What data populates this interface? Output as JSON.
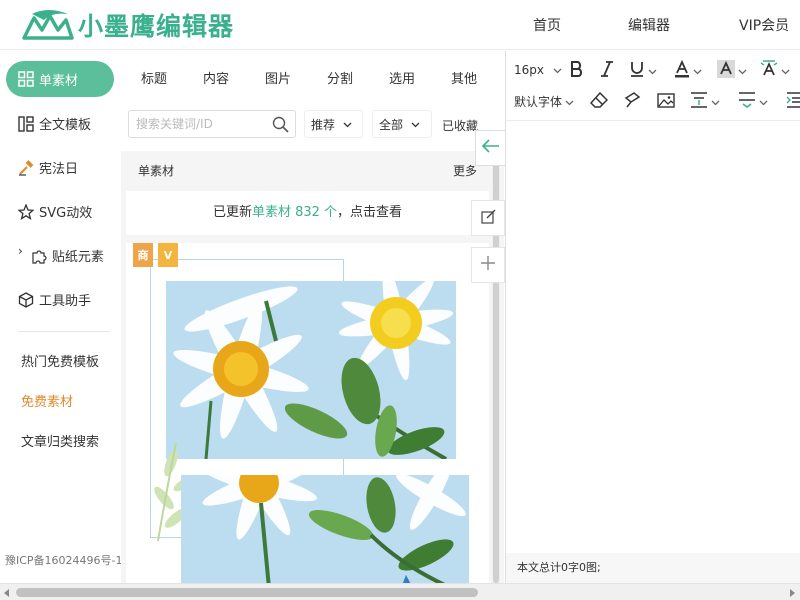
{
  "app": {
    "logo_text": "小墨鹰编辑器",
    "brand_color": "#3bb08d",
    "nav": [
      "首页",
      "编辑器",
      "VIP会员"
    ]
  },
  "sidebar": {
    "active": {
      "label": "单素材",
      "icon": "grid-icon"
    },
    "items": [
      {
        "label": "全文模板",
        "icon": "template-icon"
      },
      {
        "label": "宪法日",
        "icon": "hammer-icon"
      },
      {
        "label": "SVG动效",
        "icon": "star-icon"
      },
      {
        "label": "贴纸元素",
        "icon": "puzzle-icon"
      },
      {
        "label": "工具助手",
        "icon": "cube-icon"
      }
    ],
    "links": [
      {
        "label": "热门免费模板",
        "color": "#333333"
      },
      {
        "label": "免费素材",
        "color": "#e08a2d"
      },
      {
        "label": "文章归类搜索",
        "color": "#333333"
      }
    ],
    "icp": "豫ICP备16024496号-1"
  },
  "material": {
    "tabs": [
      "标题",
      "内容",
      "图片",
      "分割",
      "选用",
      "其他"
    ],
    "search_placeholder": "搜索关键词/ID",
    "sort_label": "推荐",
    "range_label": "全部",
    "saved_label": "已收藏",
    "list_title": "单素材",
    "more_label": "更多",
    "update_prefix": "已更新",
    "update_highlight": "单素材 832 个",
    "update_suffix": "，点击查看",
    "badges": [
      "商",
      "V"
    ]
  },
  "editor": {
    "font_size": "16px",
    "font_family": "默认字体",
    "footer": "本文总计0字0图;"
  }
}
